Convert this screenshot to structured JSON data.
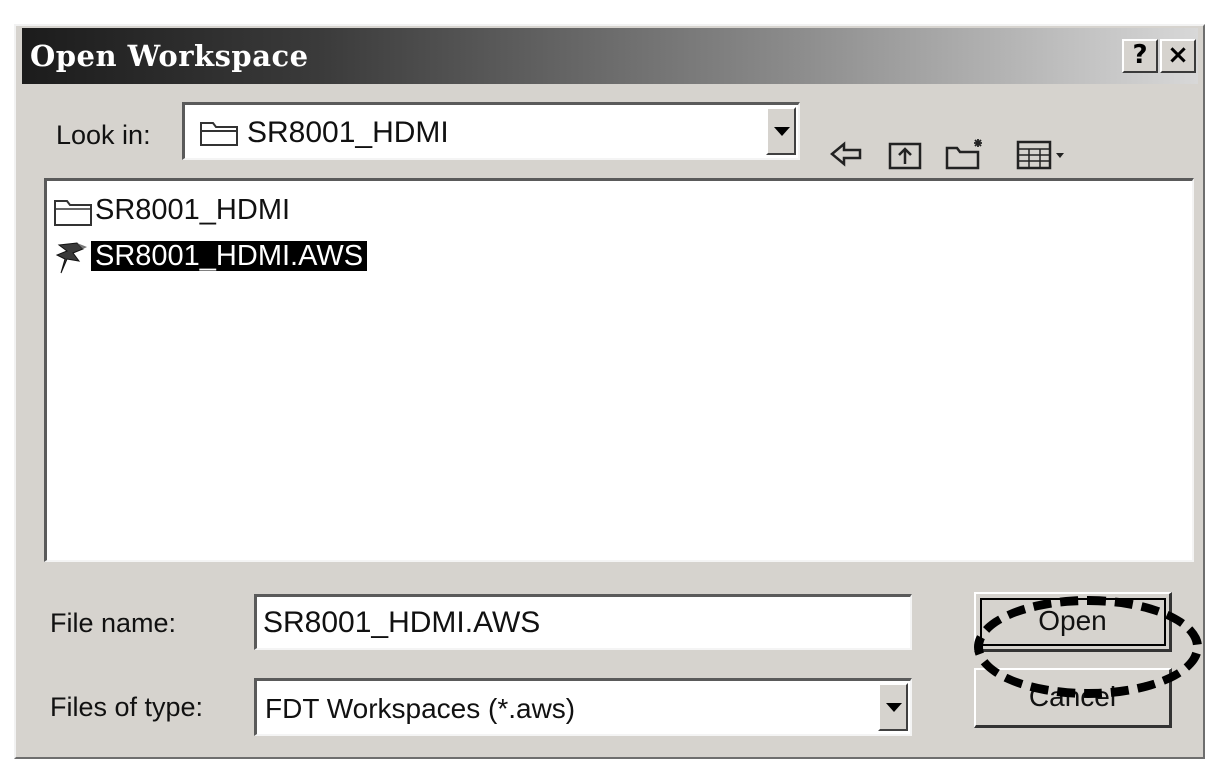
{
  "window": {
    "title": "Open Workspace",
    "help_label": "?",
    "close_label": "×"
  },
  "look_in": {
    "label": "Look in:",
    "value": "SR8001_HDMI"
  },
  "toolbar": {
    "icons": [
      "back-arrow-icon",
      "up-folder-icon",
      "new-folder-icon",
      "view-menu-icon"
    ]
  },
  "file_list": [
    {
      "name": "SR8001_HDMI",
      "icon": "folder-icon",
      "selected": false
    },
    {
      "name": "SR8001_HDMI.AWS",
      "icon": "workspace-file-icon",
      "selected": true
    }
  ],
  "file_name": {
    "label": "File name:",
    "value": "SR8001_HDMI.AWS"
  },
  "file_type": {
    "label": "Files of type:",
    "value": "FDT Workspaces (*.aws)"
  },
  "buttons": {
    "open": "Open",
    "cancel": "Cancel"
  },
  "colors": {
    "dialog_bg": "#d6d3ce",
    "selection": "#000000"
  }
}
